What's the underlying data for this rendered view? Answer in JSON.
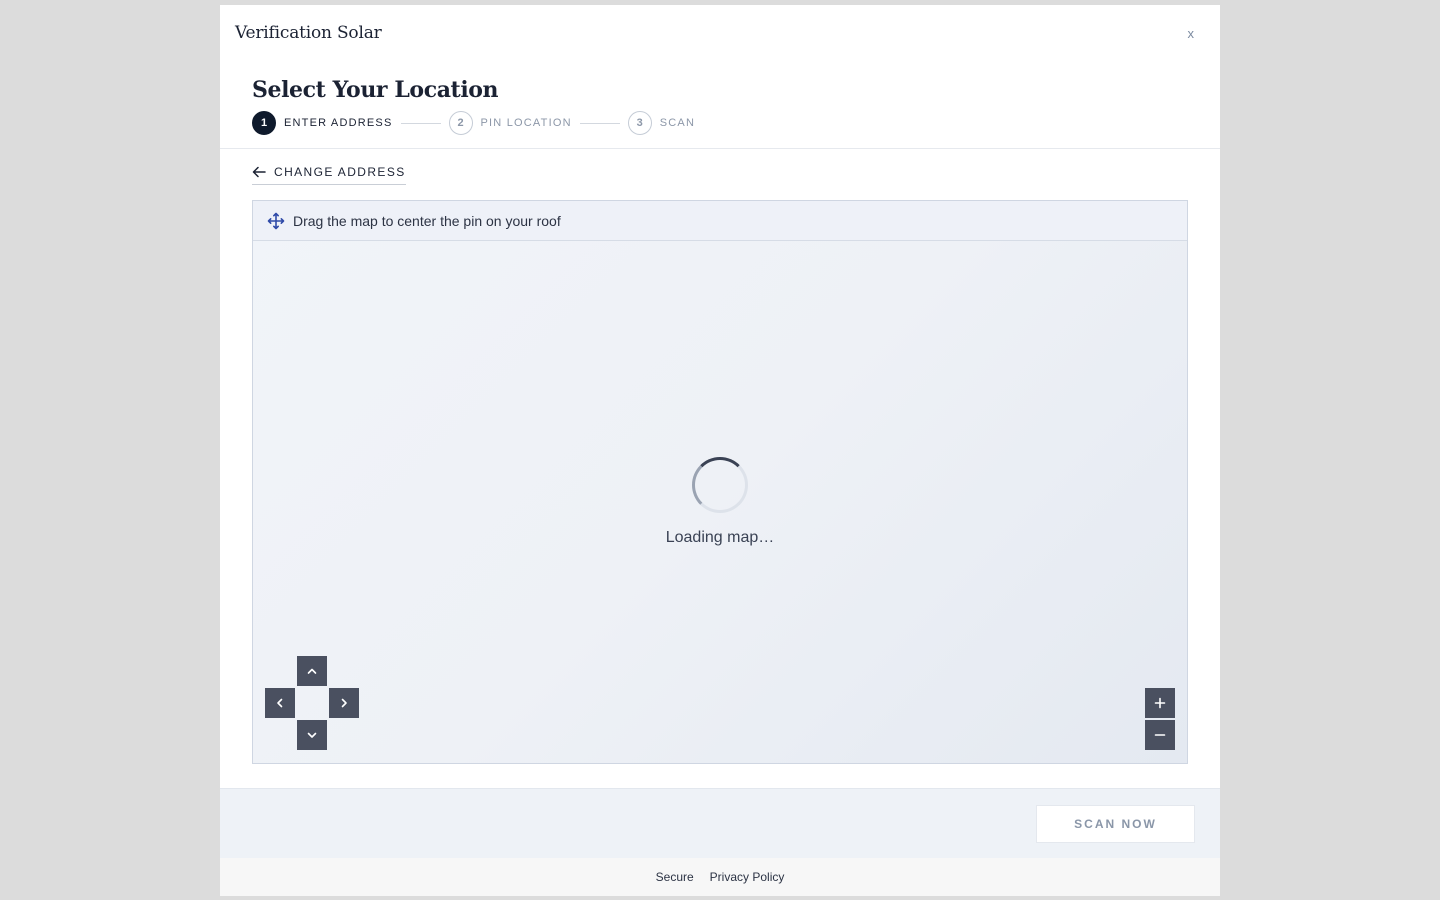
{
  "modal": {
    "brand": "Verification Solar",
    "close_label": "x",
    "page_title": "Select Your Location"
  },
  "stepper": {
    "steps": [
      {
        "number": "1",
        "label": "ENTER ADDRESS",
        "active": true
      },
      {
        "number": "2",
        "label": "PIN LOCATION",
        "active": false
      },
      {
        "number": "3",
        "label": "SCAN",
        "active": false
      }
    ]
  },
  "change_address": {
    "label": "CHANGE ADDRESS",
    "icon": "arrow-left-icon"
  },
  "map": {
    "hint": "Drag the map to center the pin on your roof",
    "hint_icon": "move-icon",
    "loading_text": "Loading map…",
    "controls": {
      "pan_up": "chevron-up-icon",
      "pan_down": "chevron-down-icon",
      "pan_left": "chevron-left-icon",
      "pan_right": "chevron-right-icon",
      "zoom_in": "plus-icon",
      "zoom_out": "minus-icon"
    }
  },
  "footer": {
    "scan_label": "SCAN NOW",
    "links": [
      "Secure",
      "Privacy Policy"
    ]
  },
  "colors": {
    "primary": "#0f1a2c",
    "accent_icon": "#2f4aa8",
    "control_bg": "#4a5060"
  }
}
